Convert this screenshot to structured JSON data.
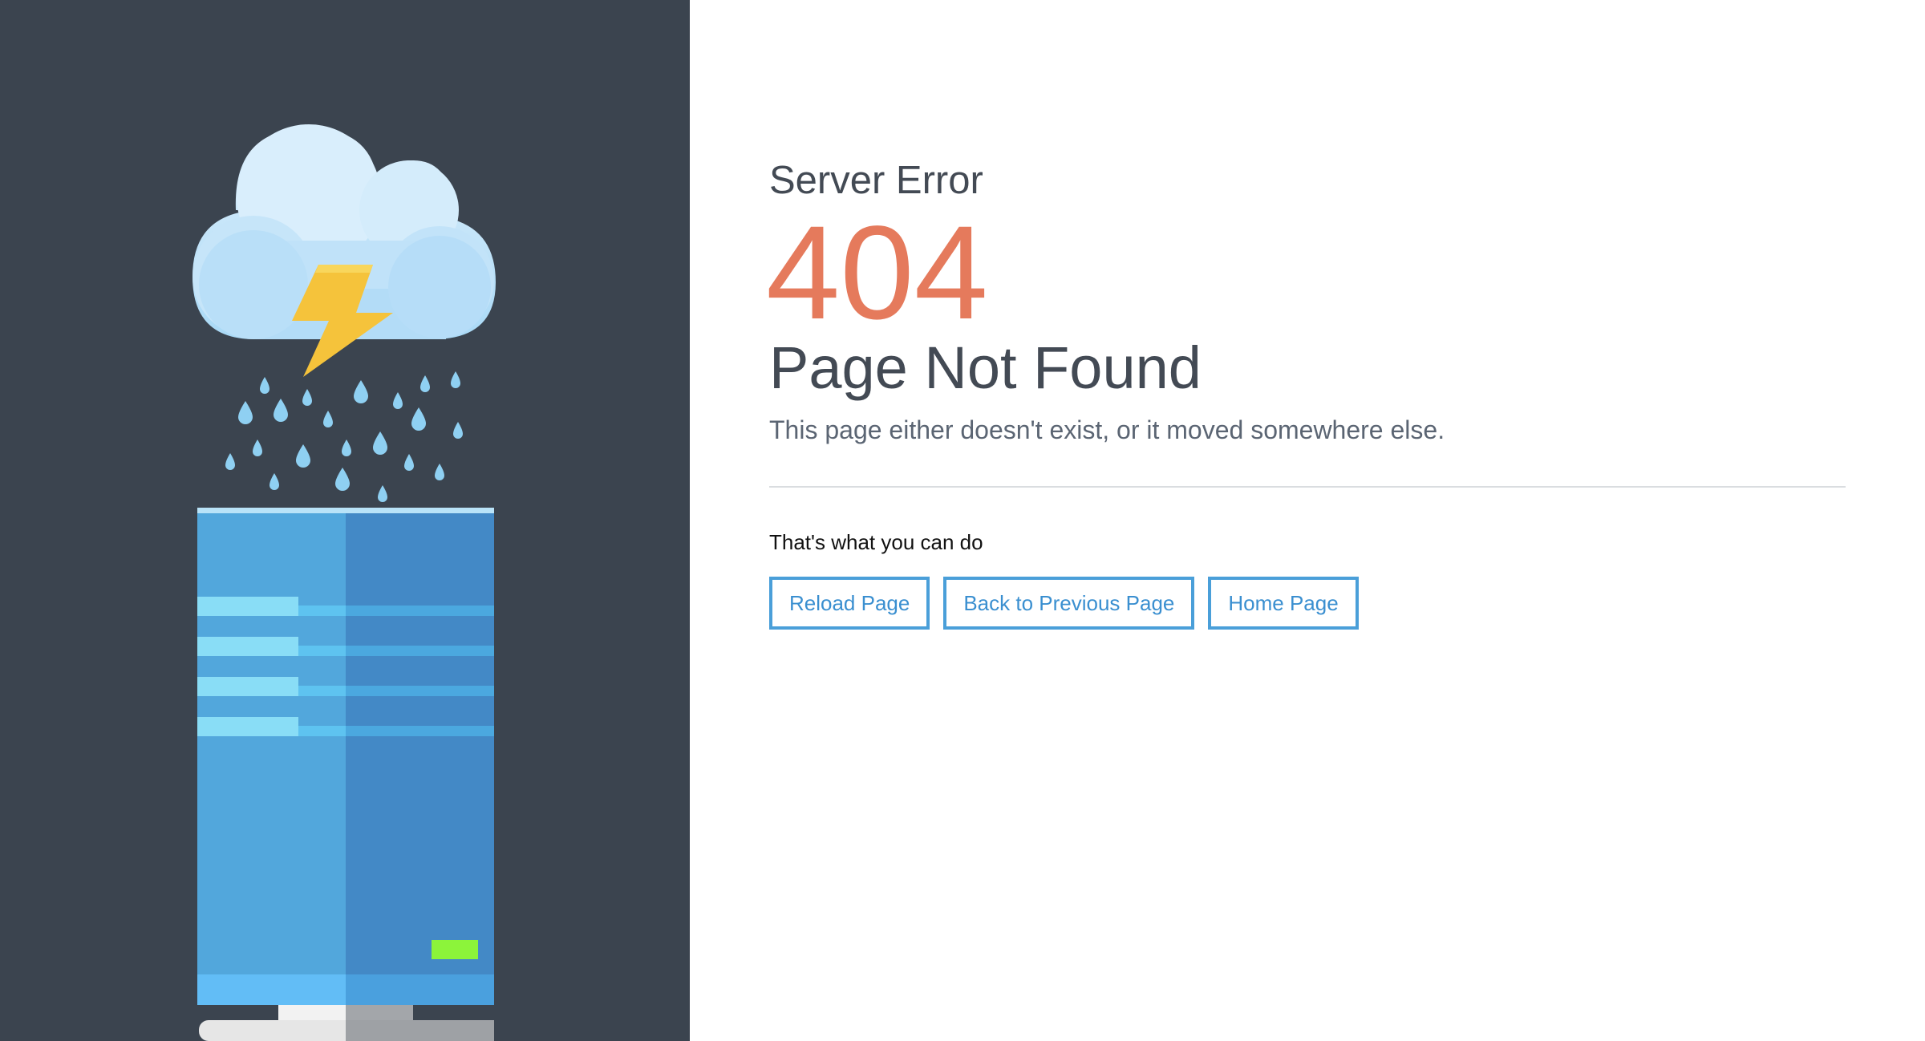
{
  "error": {
    "label": "Server Error",
    "code": "404",
    "title": "Page Not Found",
    "description": "This page either doesn't exist, or it moved somewhere else."
  },
  "actions": {
    "heading": "That's what you can do",
    "reload_label": "Reload Page",
    "back_label": "Back to Previous Page",
    "home_label": "Home Page"
  },
  "colors": {
    "left_panel": "#3b444f",
    "accent_code": "#e57a5c",
    "button_border": "#4a9fd9",
    "server_light": "#52a7dc",
    "server_dark": "#4389c6",
    "lightning": "#f5c33b",
    "cloud": "#cfe9fb",
    "status_led": "#8cf43a"
  },
  "icons": {
    "illustration": "server-rain-storm-illustration",
    "cloud": "cloud-icon",
    "lightning": "lightning-bolt-icon",
    "server": "server-tower-icon"
  }
}
